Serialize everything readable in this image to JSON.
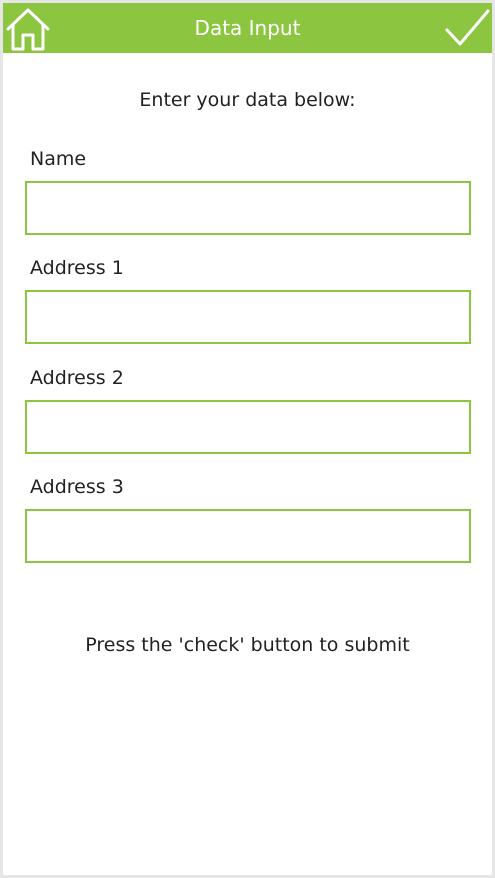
{
  "header": {
    "title": "Data Input",
    "home_icon": "home-icon",
    "check_icon": "check-icon",
    "color": "#8cc641"
  },
  "instructions": "Enter your data below:",
  "fields": [
    {
      "label": "Name",
      "value": "",
      "placeholder": ""
    },
    {
      "label": "Address 1",
      "value": "",
      "placeholder": ""
    },
    {
      "label": "Address 2",
      "value": "",
      "placeholder": ""
    },
    {
      "label": "Address 3",
      "value": "",
      "placeholder": ""
    }
  ],
  "footer": "Press the 'check' button to submit"
}
